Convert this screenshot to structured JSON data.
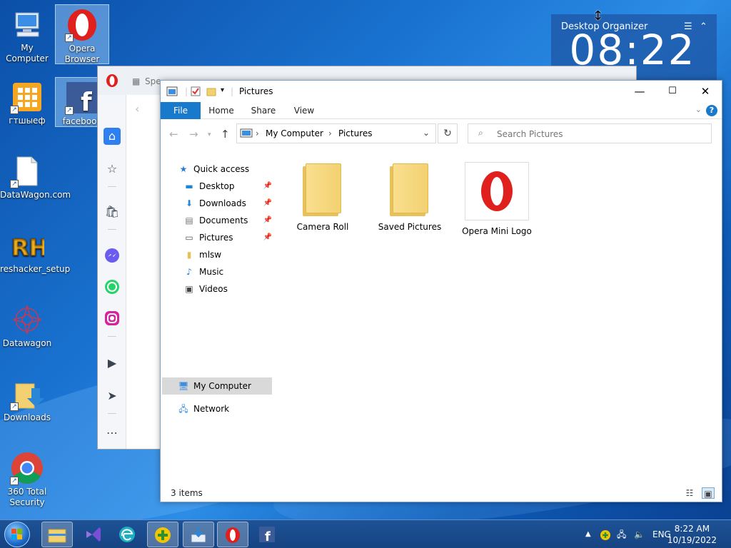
{
  "desktop": {
    "icons": [
      {
        "label": "My Computer",
        "icon": "computer-icon"
      },
      {
        "label": "Opera Browser",
        "icon": "opera-icon"
      },
      {
        "label": "гтшыеф",
        "icon": "app-grid-icon"
      },
      {
        "label": "facebook",
        "icon": "facebook-icon"
      },
      {
        "label": "DataWagon.com",
        "icon": "document-icon"
      },
      {
        "label": "reshacker_setup",
        "icon": "reshacker-icon"
      },
      {
        "label": "Datawagon",
        "icon": "datawagon-icon"
      },
      {
        "label": "Downloads",
        "icon": "downloads-folder-icon"
      },
      {
        "label": "360 Total Security",
        "icon": "chrome-icon"
      }
    ]
  },
  "organizer": {
    "title": "Desktop Organizer",
    "clock": "08:22"
  },
  "opera": {
    "tab_partial": "Spe"
  },
  "explorer": {
    "window_title": "Pictures",
    "ribbon_tabs": [
      "File",
      "Home",
      "Share",
      "View"
    ],
    "address": {
      "crumbs": [
        "My Computer",
        "Pictures"
      ]
    },
    "search_placeholder": "Search Pictures",
    "nav": {
      "quick_access": "Quick access",
      "items": [
        "Desktop",
        "Downloads",
        "Documents",
        "Pictures",
        "mlsw",
        "Music",
        "Videos"
      ],
      "my_computer": "My Computer",
      "network": "Network"
    },
    "files": [
      {
        "name": "Camera Roll",
        "type": "folder"
      },
      {
        "name": "Saved Pictures",
        "type": "folder"
      },
      {
        "name": "Opera Mini Logo",
        "type": "image"
      }
    ],
    "status": "3 items"
  },
  "taskbar": {
    "lang": "ENG",
    "time": "8:22 AM",
    "date": "10/19/2022"
  },
  "colors": {
    "accent": "#1979ca",
    "opera_red": "#e0201c",
    "folder_yellow": "#f3d170"
  }
}
